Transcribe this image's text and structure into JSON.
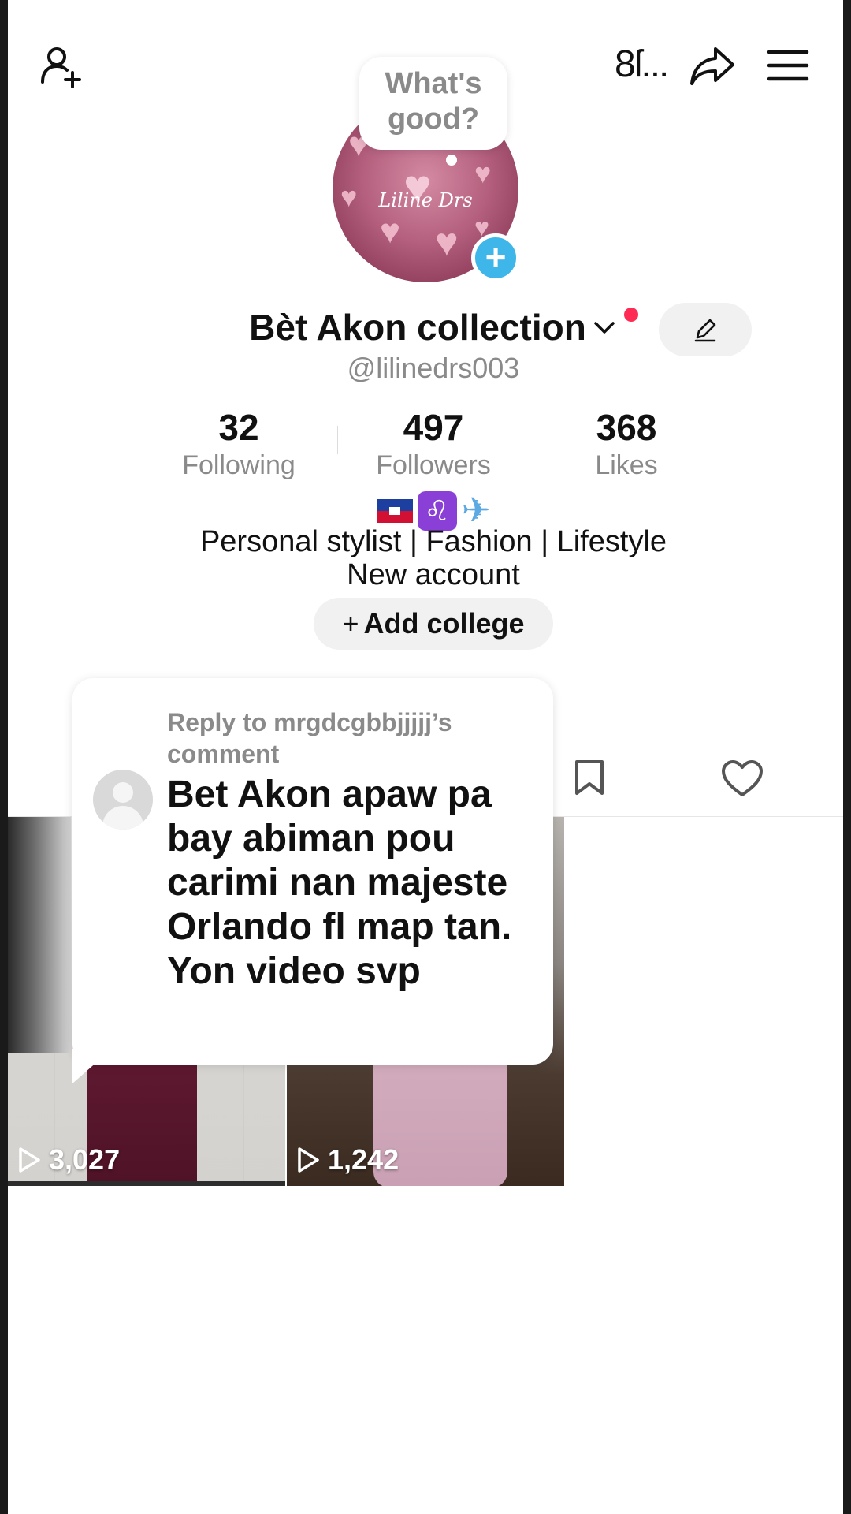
{
  "header": {
    "qr_label": "8ſ...",
    "icons": [
      "add-friend-icon",
      "share-icon",
      "menu-icon"
    ]
  },
  "note": {
    "text": "What's good?"
  },
  "profile": {
    "avatar_text": "Liline Drs",
    "display_name": "Bèt Akon collection",
    "handle": "@lilinedrs003"
  },
  "stats": [
    {
      "value": "32",
      "label": "Following"
    },
    {
      "value": "497",
      "label": "Followers"
    },
    {
      "value": "368",
      "label": "Likes"
    }
  ],
  "bio": {
    "line1": "Personal stylist | Fashion | Lifestyle",
    "line2": "New account"
  },
  "add_college": {
    "plus": "+",
    "label": "Add college"
  },
  "videos": [
    {
      "views": "3,027"
    },
    {
      "views": "1,242"
    }
  ],
  "reply_sticker": {
    "heading": "Reply to mrgdcgbbjjjjj’s comment",
    "comment": "Bet Akon apaw pa bay abiman pou carimi nan majeste Orlando fl map tan. Yon video svp"
  },
  "colors": {
    "accent_blue": "#3fb6e9",
    "notification_red": "#fe2c55",
    "muted_text": "#8a8a8a"
  }
}
